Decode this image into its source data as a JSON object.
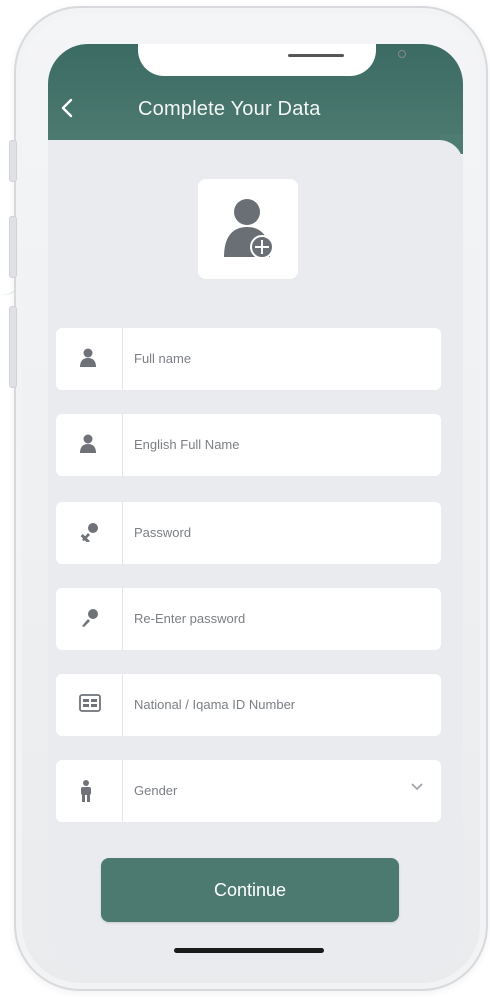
{
  "header": {
    "title": "Complete Your Data",
    "back_icon": "chevron-left-icon"
  },
  "avatar": {
    "icon": "add-user-icon"
  },
  "form": {
    "fields": [
      {
        "icon": "user-icon",
        "placeholder": "Full name"
      },
      {
        "icon": "user-icon",
        "placeholder": "English Full Name"
      },
      {
        "icon": "key-icon",
        "placeholder": "Password"
      },
      {
        "icon": "key-icon",
        "placeholder": "Re-Enter password"
      },
      {
        "icon": "id-card-icon",
        "placeholder": "National / Iqama ID Number"
      },
      {
        "icon": "person-icon",
        "placeholder": "Gender",
        "dropdown": true
      }
    ]
  },
  "continue_label": "Continue",
  "colors": {
    "primary": "#4c7a70",
    "header": "#3b6b63",
    "background": "#e9ebee"
  }
}
